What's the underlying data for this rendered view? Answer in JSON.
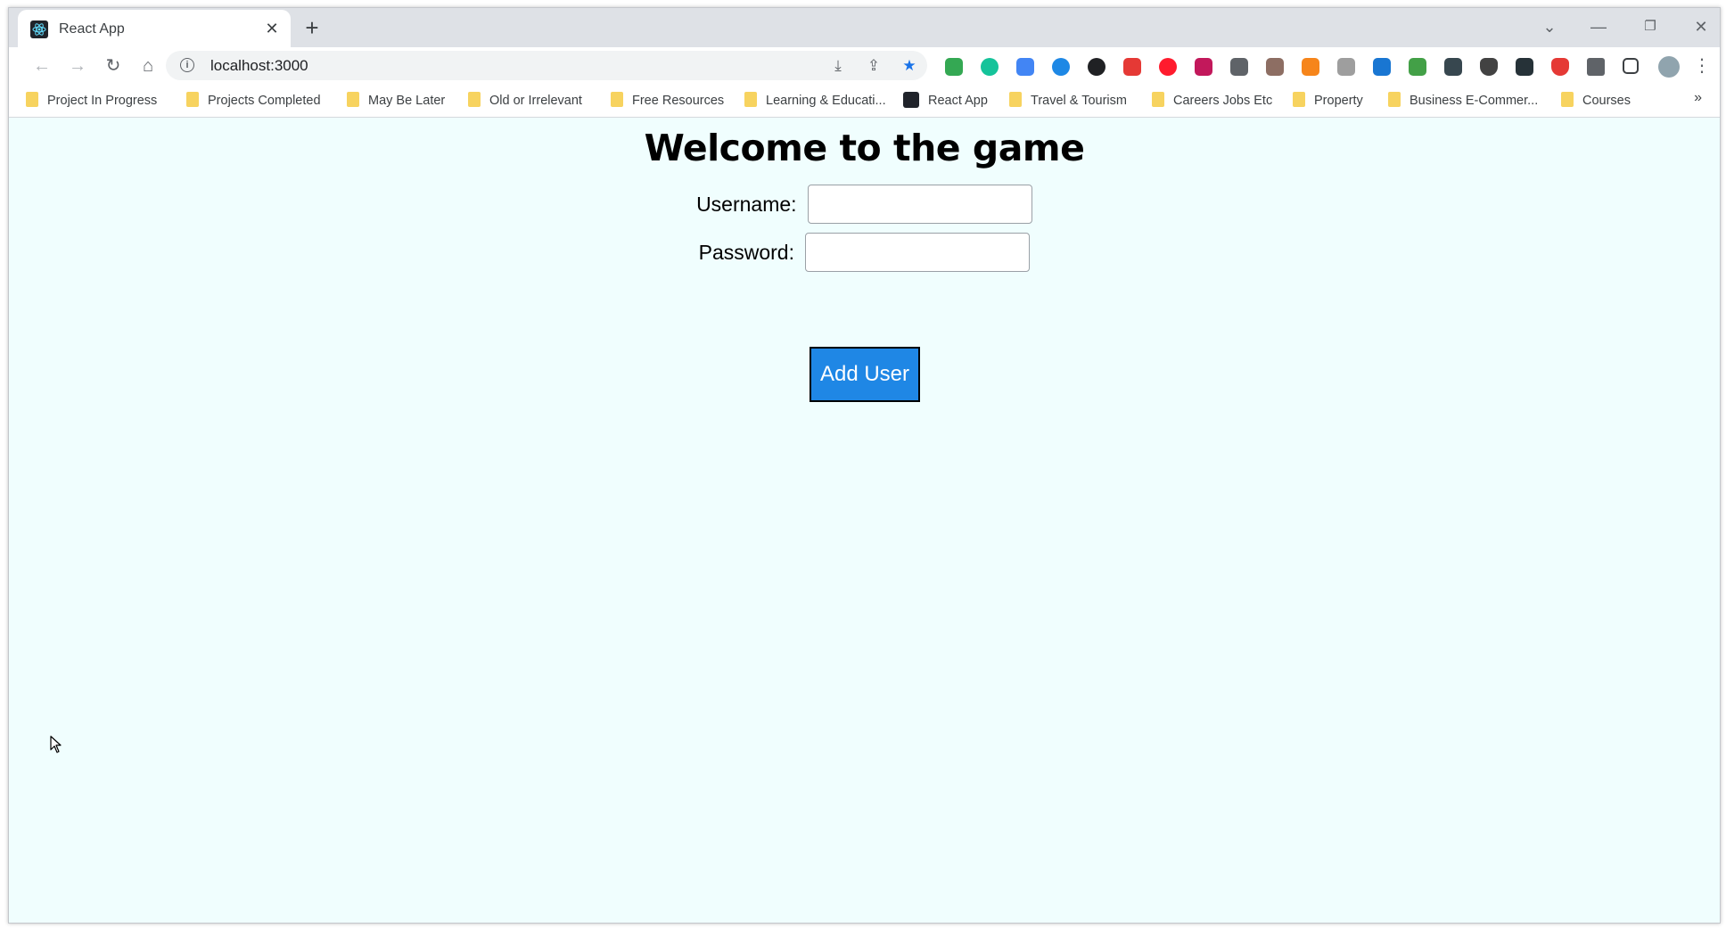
{
  "browser": {
    "tab": {
      "title": "React App"
    },
    "address_bar": {
      "url": "localhost:3000"
    },
    "bookmarks": [
      "Project In Progress",
      "Projects Completed",
      "May Be Later",
      "Old or Irrelevant",
      "Free Resources",
      "Learning & Educati...",
      "React App",
      "Travel & Tourism",
      "Careers Jobs Etc",
      "Property",
      "Business E-Commer...",
      "Courses"
    ],
    "bookmarks_overflow": "»"
  },
  "page": {
    "heading": "Welcome to the game",
    "username_label": "Username:",
    "username_value": "",
    "password_label": "Password:",
    "password_value": "",
    "submit_label": "Add User"
  },
  "colors": {
    "page_background": "#f0fefe",
    "button_background": "#1f87e5",
    "bookmark_folder": "#f7d35f"
  }
}
